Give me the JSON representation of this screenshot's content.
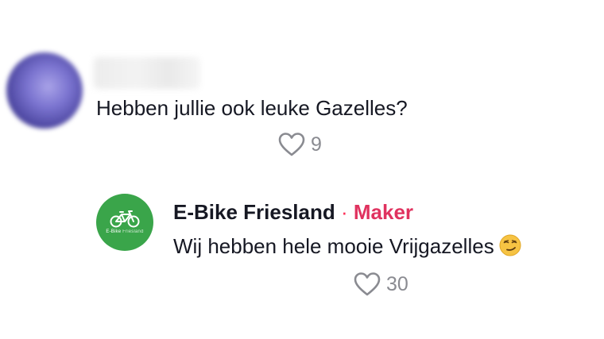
{
  "comment": {
    "text": "Hebben jullie ook leuke Gazelles?",
    "likes": "9"
  },
  "reply": {
    "author": "E-Bike Friesland",
    "separator": "·",
    "role": "Maker",
    "text": "Wij hebben hele mooie Vrijgazelles",
    "emoji": "smirking-face",
    "likes": "30",
    "avatar_logo_text_bold": "E-Bike",
    "avatar_logo_text_light": "Friesland"
  },
  "colors": {
    "maker_avatar_bg": "#3aa54a",
    "maker_label": "#e0325f",
    "like_count": "#8a8b91"
  }
}
